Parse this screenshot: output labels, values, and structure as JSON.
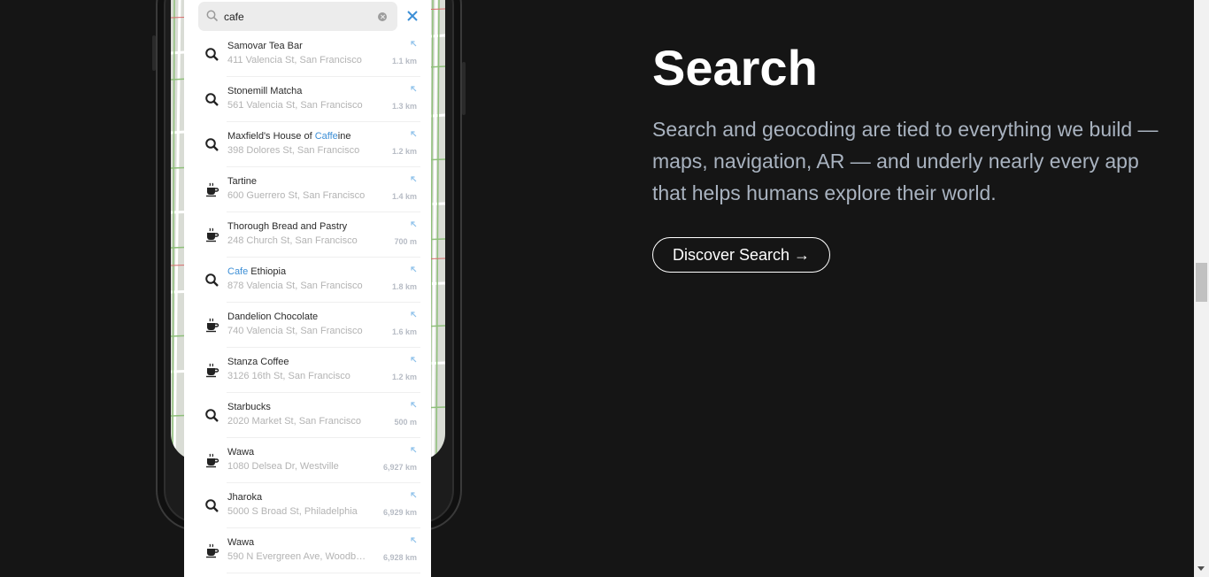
{
  "search_demo": {
    "query": "cafe",
    "results": [
      {
        "icon": "search-icon",
        "name_pre": "Samovar Tea Bar",
        "name_hl": "",
        "name_post": "",
        "address": "411 Valencia St, San Francisco",
        "distance": "1.1 km"
      },
      {
        "icon": "search-icon",
        "name_pre": "Stonemill Matcha",
        "name_hl": "",
        "name_post": "",
        "address": "561 Valencia St, San Francisco",
        "distance": "1.3 km"
      },
      {
        "icon": "search-icon",
        "name_pre": "Maxfield's House of ",
        "name_hl": "Caffe",
        "name_post": "ine",
        "address": "398 Dolores St, San Francisco",
        "distance": "1.2 km"
      },
      {
        "icon": "coffee-cup-icon",
        "name_pre": "Tartine",
        "name_hl": "",
        "name_post": "",
        "address": "600 Guerrero St, San Francisco",
        "distance": "1.4 km"
      },
      {
        "icon": "coffee-cup-icon",
        "name_pre": "Thorough Bread and Pastry",
        "name_hl": "",
        "name_post": "",
        "address": "248 Church St, San Francisco",
        "distance": "700 m"
      },
      {
        "icon": "search-icon",
        "name_pre": "",
        "name_hl": "Cafe",
        "name_post": " Ethiopia",
        "address": "878 Valencia St, San Francisco",
        "distance": "1.8 km"
      },
      {
        "icon": "coffee-cup-icon",
        "name_pre": "Dandelion Chocolate",
        "name_hl": "",
        "name_post": "",
        "address": "740 Valencia St, San Francisco",
        "distance": "1.6 km"
      },
      {
        "icon": "coffee-cup-icon",
        "name_pre": "Stanza Coffee",
        "name_hl": "",
        "name_post": "",
        "address": "3126 16th St, San Francisco",
        "distance": "1.2 km"
      },
      {
        "icon": "search-icon",
        "name_pre": "Starbucks",
        "name_hl": "",
        "name_post": "",
        "address": "2020 Market St, San Francisco",
        "distance": "500 m"
      },
      {
        "icon": "coffee-cup-icon",
        "name_pre": "Wawa",
        "name_hl": "",
        "name_post": "",
        "address": "1080 Delsea Dr, Westville",
        "distance": "6,927 km"
      },
      {
        "icon": "search-icon",
        "name_pre": "Jharoka",
        "name_hl": "",
        "name_post": "",
        "address": "5000 S Broad St, Philadelphia",
        "distance": "6,929 km"
      },
      {
        "icon": "coffee-cup-icon",
        "name_pre": "Wawa",
        "name_hl": "",
        "name_post": "",
        "address": "590 N Evergreen Ave, Woodb…",
        "distance": "6,928 km"
      }
    ]
  },
  "section": {
    "title": "Search",
    "description": "Search and geocoding are tied to everything we build — maps, navigation, AR — and underly nearly every app that helps humans explore their world.",
    "cta_label": "Discover Search →"
  },
  "colors": {
    "page_bg": "#151515",
    "highlight": "#3d8fd6",
    "description": "#a9b3c0"
  }
}
